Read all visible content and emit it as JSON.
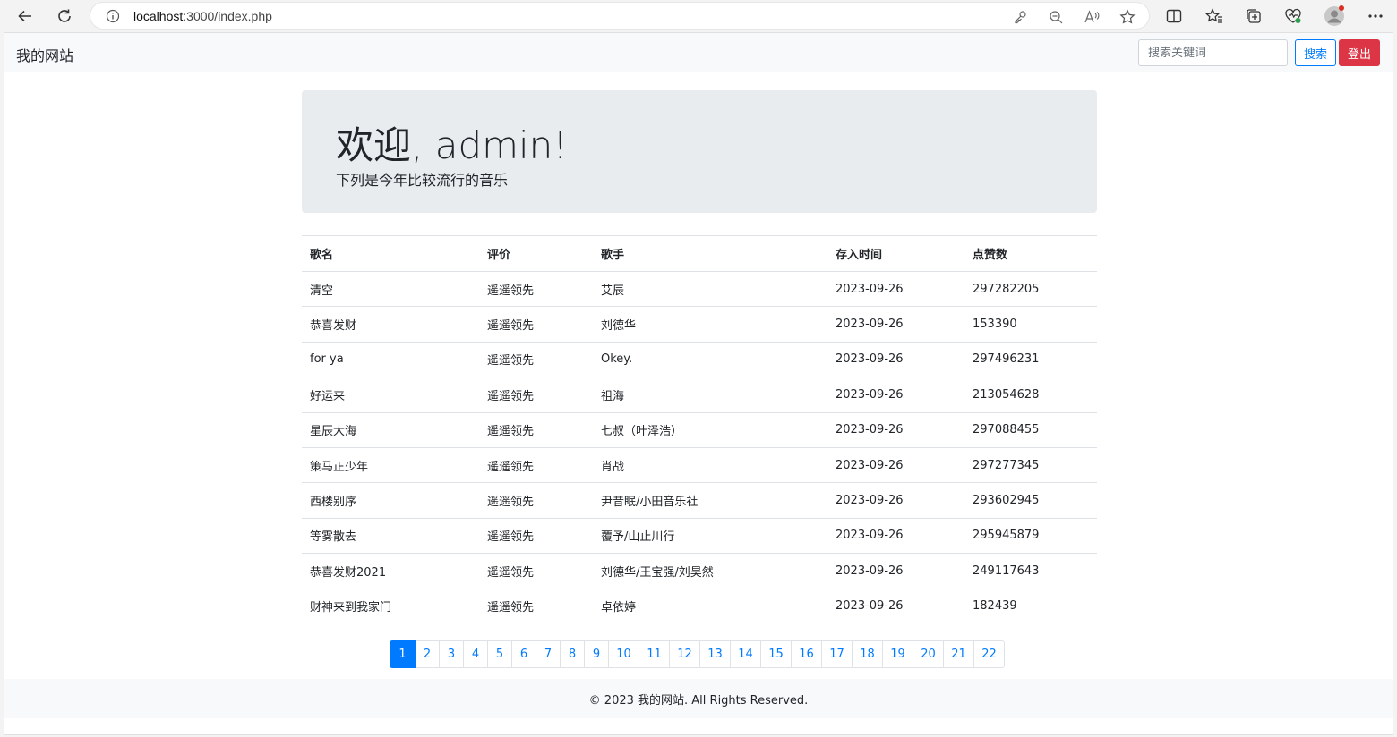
{
  "browser": {
    "url_host": "localhost",
    "url_rest": ":3000/index.php"
  },
  "navbar": {
    "brand": "我的网站",
    "search_placeholder": "搜索关键词",
    "search_label": "搜索",
    "logout_label": "登出"
  },
  "hero": {
    "title": "欢迎, admin!",
    "subtitle": "下列是今年比较流行的音乐"
  },
  "table": {
    "headers": [
      "歌名",
      "评价",
      "歌手",
      "存入时间",
      "点赞数"
    ],
    "rows": [
      [
        "清空",
        "遥遥领先",
        "艾辰",
        "2023-09-26",
        "297282205"
      ],
      [
        "恭喜发财",
        "遥遥领先",
        "刘德华",
        "2023-09-26",
        "153390"
      ],
      [
        "for ya",
        "遥遥领先",
        "Okey.",
        "2023-09-26",
        "297496231"
      ],
      [
        "好运来",
        "遥遥领先",
        "祖海",
        "2023-09-26",
        "213054628"
      ],
      [
        "星辰大海",
        "遥遥领先",
        "七叔（叶泽浩）",
        "2023-09-26",
        "297088455"
      ],
      [
        "策马正少年",
        "遥遥领先",
        "肖战",
        "2023-09-26",
        "297277345"
      ],
      [
        "西楼别序",
        "遥遥领先",
        "尹昔眠/小田音乐社",
        "2023-09-26",
        "293602945"
      ],
      [
        "等雾散去",
        "遥遥领先",
        "覆予/山止川行",
        "2023-09-26",
        "295945879"
      ],
      [
        "恭喜发财2021",
        "遥遥领先",
        "刘德华/王宝强/刘昊然",
        "2023-09-26",
        "249117643"
      ],
      [
        "财神来到我家门",
        "遥遥领先",
        "卓依婷",
        "2023-09-26",
        "182439"
      ]
    ]
  },
  "pagination": {
    "pages": [
      "1",
      "2",
      "3",
      "4",
      "5",
      "6",
      "7",
      "8",
      "9",
      "10",
      "11",
      "12",
      "13",
      "14",
      "15",
      "16",
      "17",
      "18",
      "19",
      "20",
      "21",
      "22"
    ],
    "active": "1"
  },
  "footer": {
    "text": "© 2023 我的网站. All Rights Reserved."
  },
  "colors": {
    "primary": "#007bff",
    "danger": "#dc3545",
    "hero_bg": "#e9ecef",
    "navbar_bg": "#f8f9fa"
  },
  "icons": [
    "back-arrow-icon",
    "refresh-icon",
    "info-icon",
    "key-icon",
    "zoom-out-icon",
    "read-aloud-icon",
    "favorite-star-icon",
    "split-screen-icon",
    "favorites-icon",
    "collections-icon",
    "browser-essentials-icon",
    "profile-avatar-icon",
    "more-menu-icon"
  ]
}
